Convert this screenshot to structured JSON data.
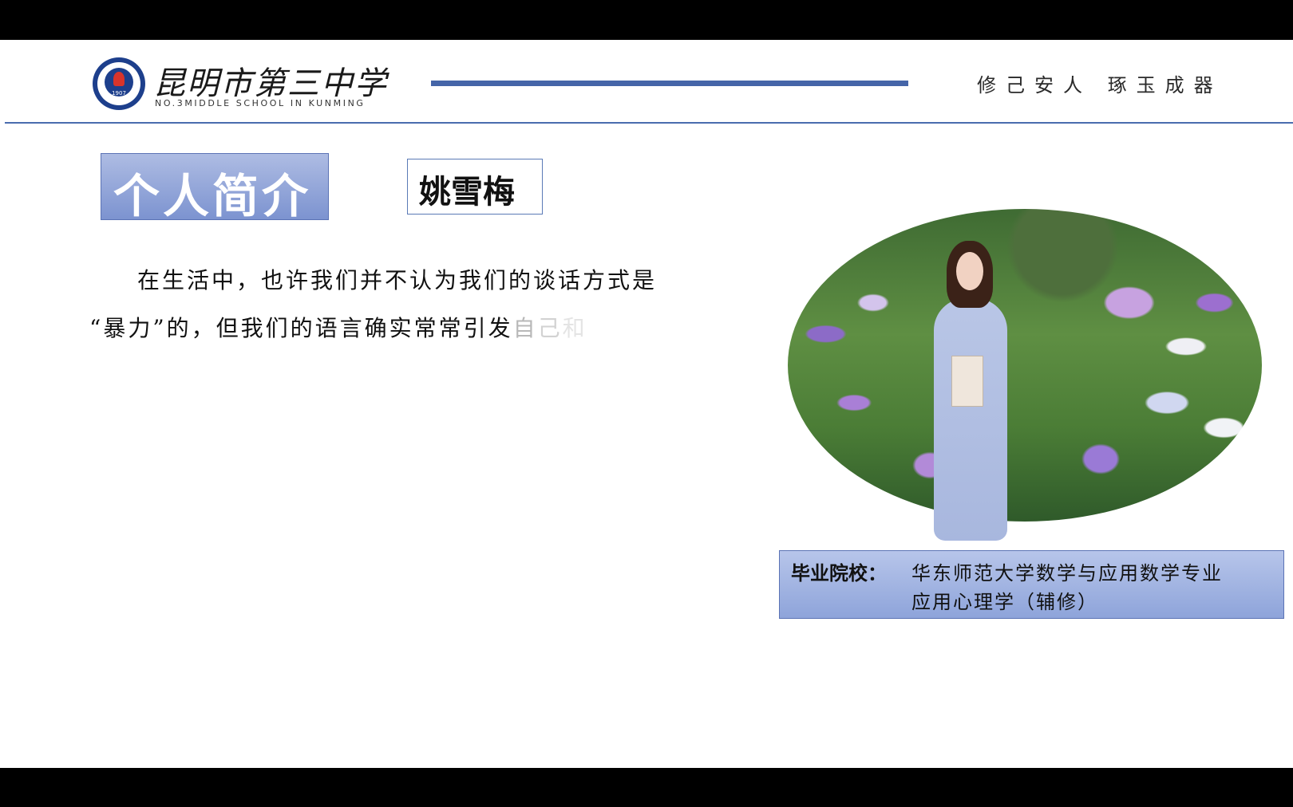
{
  "header": {
    "logo_year": "1907",
    "school_name_cn": "昆明市第三中学",
    "school_name_en": "NO.3MIDDLE SCHOOL IN KUNMING",
    "motto": "修己安人 琢玉成器"
  },
  "slide": {
    "title": "个人简介",
    "name": "姚雪梅",
    "paragraph": {
      "line1": "在生活中，也许我们并不认为我们的谈话方式是",
      "line2_main": "“暴力”的，但我们的语言确实常常引发",
      "line2_fade1": "自",
      "line2_fade2": "己",
      "line2_fade3": "和"
    },
    "education": {
      "label": "毕业院校：",
      "line1": "华东师范大学数学与应用数学专业",
      "line2": "应用心理学（辅修）"
    }
  },
  "colors": {
    "accent_blue": "#4565a8",
    "title_box": "#8ea4da",
    "letterbox": "#000000"
  }
}
